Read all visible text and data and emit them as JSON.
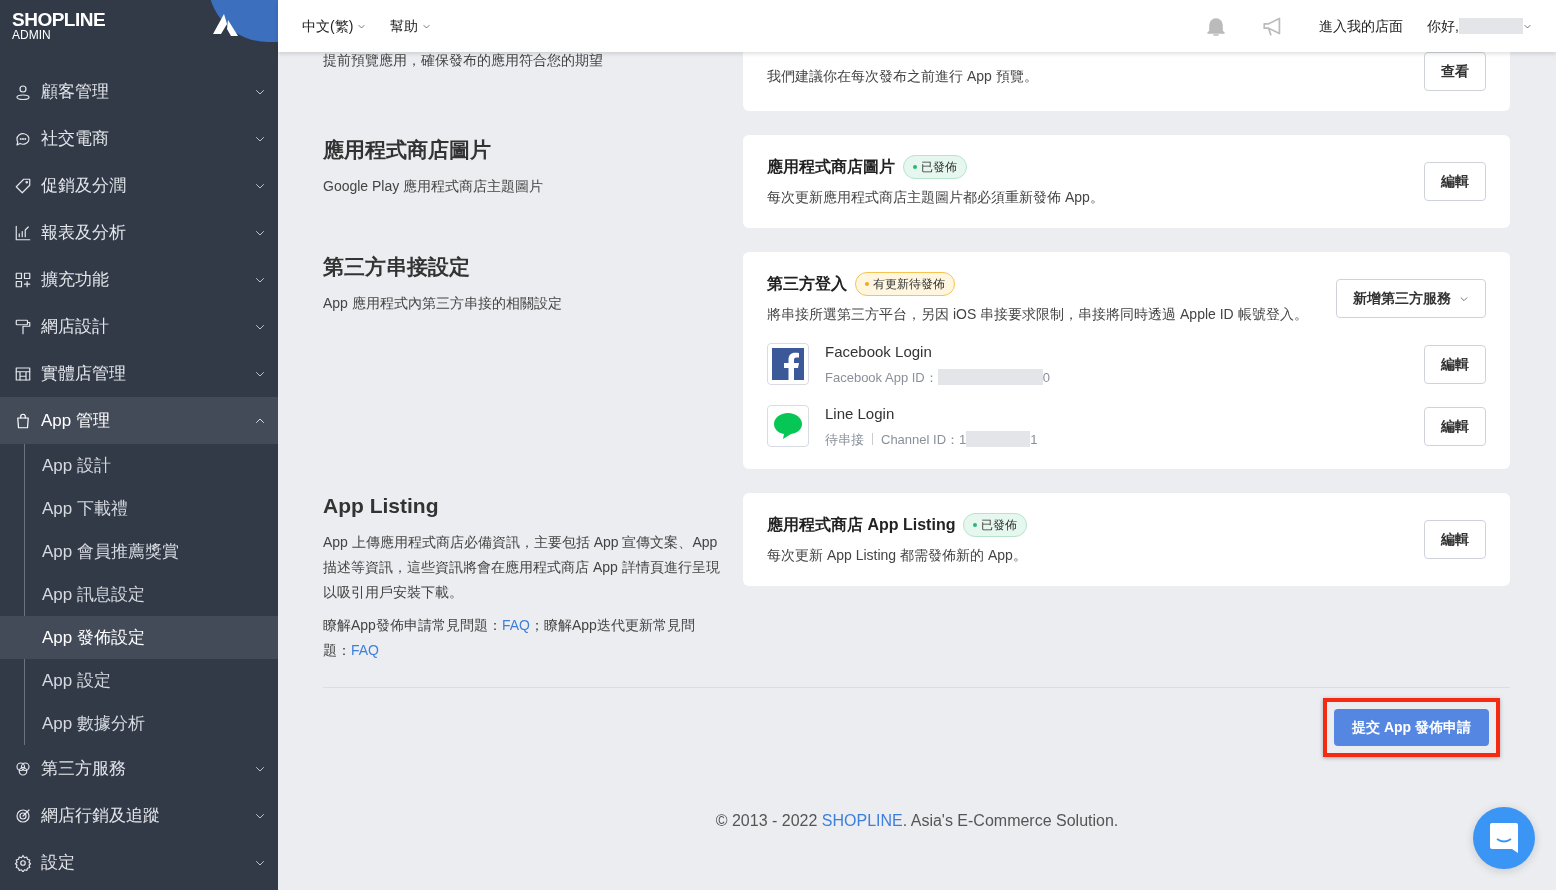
{
  "brand": {
    "name": "SHOPLINE",
    "sub": "ADMIN"
  },
  "sidebar": {
    "items": [
      {
        "label": "顧客管理",
        "expanded": false
      },
      {
        "label": "社交電商",
        "expanded": false
      },
      {
        "label": "促銷及分潤",
        "expanded": false
      },
      {
        "label": "報表及分析",
        "expanded": false
      },
      {
        "label": "擴充功能",
        "expanded": false
      },
      {
        "label": "網店設計",
        "expanded": false
      },
      {
        "label": "實體店管理",
        "expanded": false
      },
      {
        "label": "App 管理",
        "expanded": true,
        "children": [
          {
            "label": "App 設計",
            "selected": false
          },
          {
            "label": "App 下載禮",
            "selected": false
          },
          {
            "label": "App 會員推薦獎賞",
            "selected": false
          },
          {
            "label": "App 訊息設定",
            "selected": false
          },
          {
            "label": "App 發佈設定",
            "selected": true
          },
          {
            "label": "App 設定",
            "selected": false
          },
          {
            "label": "App 數據分析",
            "selected": false
          }
        ]
      },
      {
        "label": "第三方服務",
        "expanded": false
      },
      {
        "label": "網店行銷及追蹤",
        "expanded": false
      },
      {
        "label": "設定",
        "expanded": false
      }
    ]
  },
  "topbar": {
    "language": "中文(繁)",
    "help": "幫助",
    "store_link": "進入我的店面",
    "greeting": "你好,"
  },
  "sections": [
    {
      "description": "提前預覽應用，確保發布的應用符合您的期望",
      "cards": [
        {
          "description": "我們建議你在每次發布之前進行 App 預覽。",
          "button": "查看"
        }
      ]
    },
    {
      "title": "應用程式商店圖片",
      "description": "Google Play 應用程式商店主題圖片",
      "cards": [
        {
          "title": "應用程式商店圖片",
          "badge": {
            "label": "已發佈",
            "kind": "published"
          },
          "description": "每次更新應用程式商店主題圖片都必須重新發佈 App。",
          "button": "編輯"
        }
      ]
    },
    {
      "title": "第三方串接設定",
      "description": "App 應用程式內第三方串接的相關設定",
      "cards": [
        {
          "title": "第三方登入",
          "badge": {
            "label": "有更新待發佈",
            "kind": "pending"
          },
          "description": "將串接所選第三方平台，另因 iOS 串接要求限制，串接將同時透過 Apple ID 帳號登入。",
          "dropdown": "新增第三方服務",
          "logins": [
            {
              "kind": "facebook",
              "name": "Facebook Login",
              "meta": [
                "Facebook App ID："
              ],
              "id_end": "0",
              "button": "編輯"
            },
            {
              "kind": "line",
              "name": "Line Login",
              "meta": [
                "待串接",
                "Channel ID：1"
              ],
              "id_end": "1",
              "button": "編輯"
            }
          ]
        }
      ]
    },
    {
      "title": "App Listing",
      "description": "App 上傳應用程式商店必備資訊，主要包括 App 宣傳文案、App 描述等資訊，這些資訊將會在應用程式商店 App 詳情頁進行呈現以吸引用戶安裝下載。",
      "faq": [
        {
          "kind": "text",
          "text": "瞭解App發佈申請常見問題："
        },
        {
          "kind": "link",
          "text": "FAQ"
        },
        {
          "kind": "text",
          "text": "；瞭解App迭代更新常見問題："
        },
        {
          "kind": "link",
          "text": "FAQ"
        }
      ],
      "cards": [
        {
          "title": "應用程式商店 App Listing",
          "badge": {
            "label": "已發佈",
            "kind": "published"
          },
          "description": "每次更新 App Listing 都需發佈新的 App。",
          "button": "編輯"
        }
      ]
    }
  ],
  "submit": {
    "label": "提交 App 發佈申請",
    "highlighted": true
  },
  "footer": [
    {
      "kind": "text",
      "text": "© 2013 - 2022 "
    },
    {
      "kind": "link",
      "text": "SHOPLINE"
    },
    {
      "kind": "text",
      "text": ". Asia's E-Commerce Solution."
    }
  ]
}
